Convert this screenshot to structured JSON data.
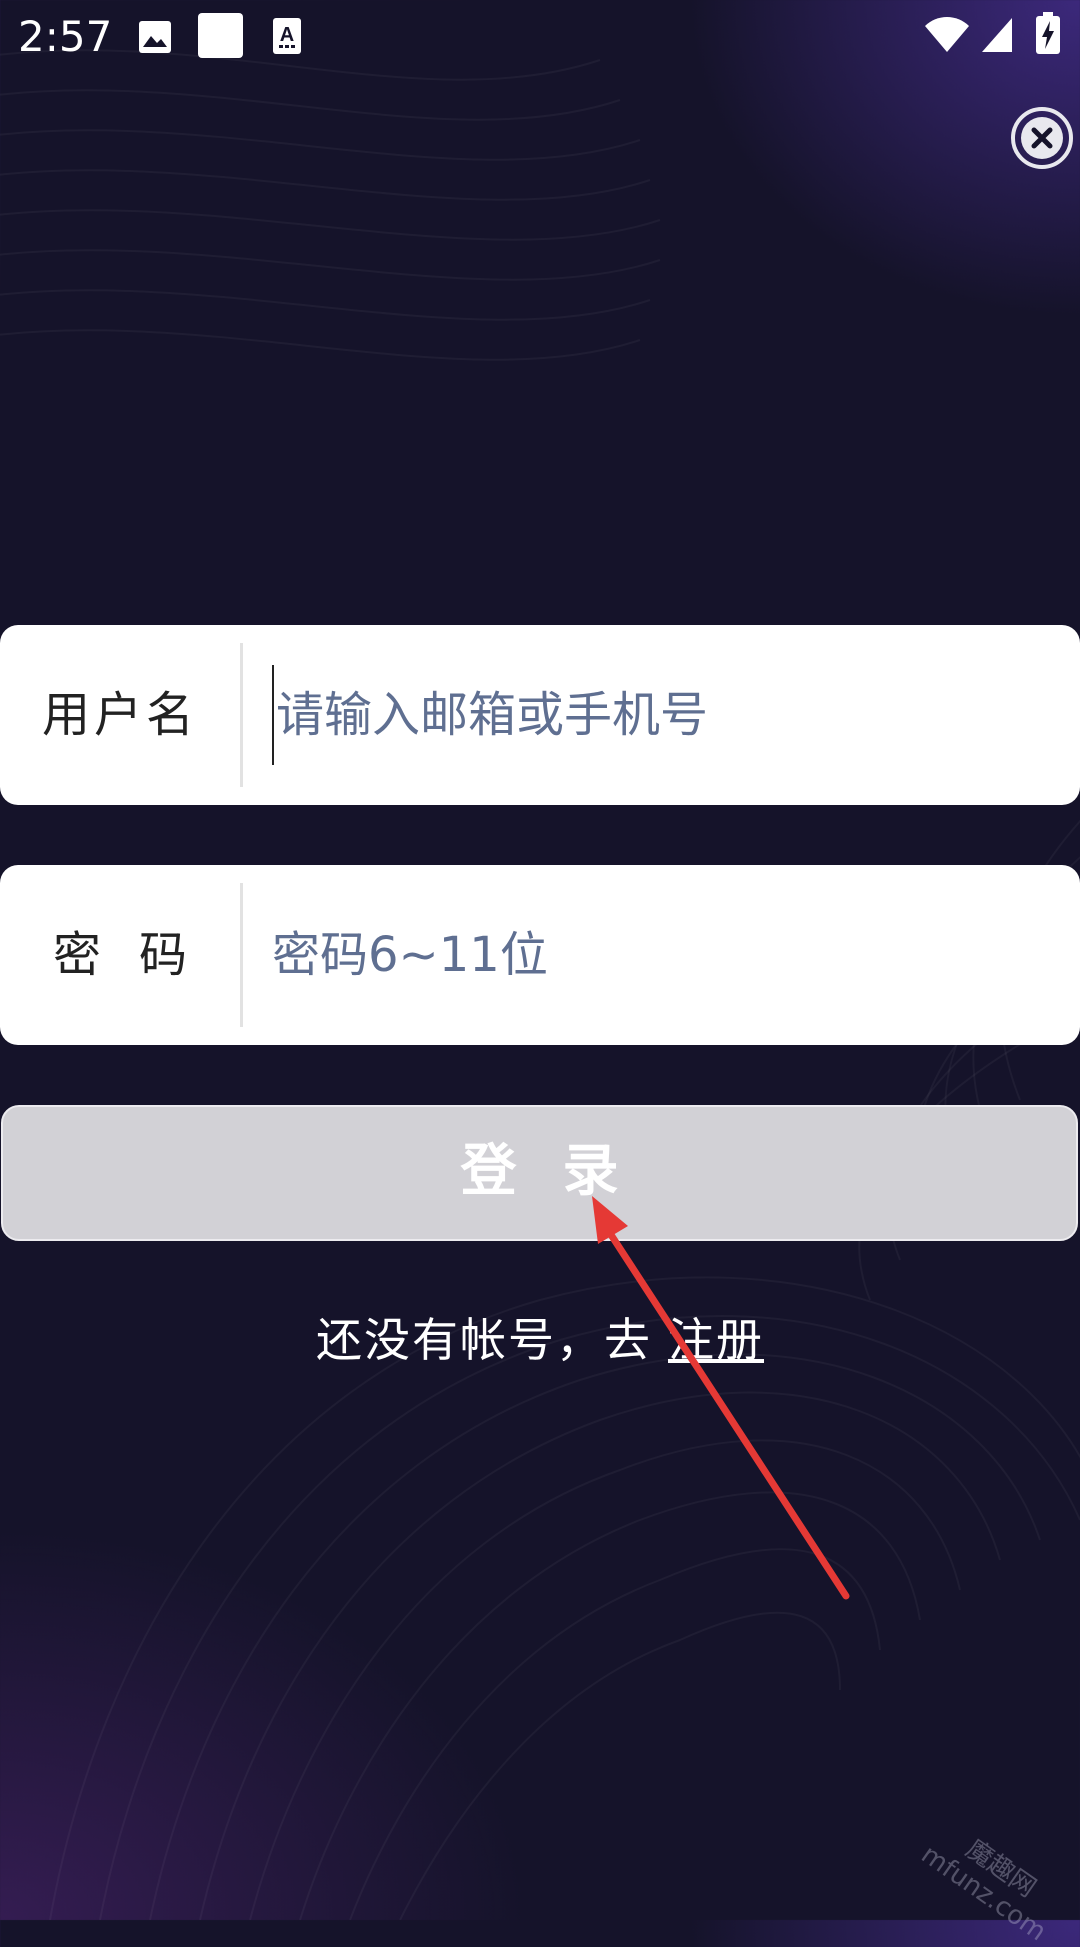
{
  "status_bar": {
    "time": "2:57",
    "icons": [
      "image-icon",
      "square-notification-icon",
      "a-keyboard-icon",
      "wifi-icon",
      "signal-icon",
      "battery-charging-icon"
    ]
  },
  "close_button": {
    "icon": "close-circle-icon"
  },
  "username_field": {
    "label": "用户名",
    "placeholder": "请输入邮箱或手机号",
    "value": ""
  },
  "password_field": {
    "label": "密码",
    "placeholder": "密码6~11位",
    "value": ""
  },
  "login_button": {
    "label": "登录"
  },
  "register": {
    "prompt": "还没有帐号，去",
    "link": "注册"
  },
  "watermark": {
    "text_top": "魔趣网",
    "text_bottom": "mfunz.com"
  },
  "colors": {
    "background": "#15132a",
    "accent_purple": "#5c3abe",
    "field_background": "#ffffff",
    "placeholder": "#5f6f91",
    "button_disabled": "#d2d1d6",
    "annotation_arrow": "#e53935"
  }
}
